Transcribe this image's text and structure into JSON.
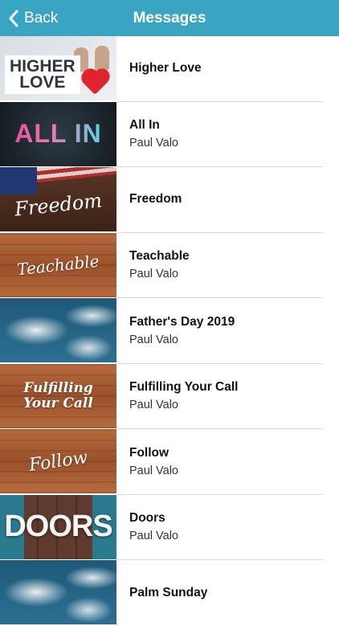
{
  "nav": {
    "back_label": "Back",
    "title": "Messages",
    "bar_color": "#3aa5c2"
  },
  "messages": [
    {
      "title": "Higher Love",
      "subtitle": "",
      "thumb_text": "HIGHER\nLOVE"
    },
    {
      "title": "All In",
      "subtitle": "Paul Valo",
      "thumb_text": "ALL IN"
    },
    {
      "title": "Freedom",
      "subtitle": "",
      "thumb_text": "Freedom"
    },
    {
      "title": "Teachable",
      "subtitle": "Paul Valo",
      "thumb_text": "Teachable"
    },
    {
      "title": "Father's Day 2019",
      "subtitle": "Paul Valo",
      "thumb_text": ""
    },
    {
      "title": "Fulfilling Your Call",
      "subtitle": "Paul Valo",
      "thumb_text": "Fulfilling\nYour Call"
    },
    {
      "title": "Follow",
      "subtitle": "Paul Valo",
      "thumb_text": "Follow"
    },
    {
      "title": "Doors",
      "subtitle": "Paul Valo",
      "thumb_text": "DOORS"
    },
    {
      "title": "Palm Sunday",
      "subtitle": "",
      "thumb_text": ""
    }
  ]
}
